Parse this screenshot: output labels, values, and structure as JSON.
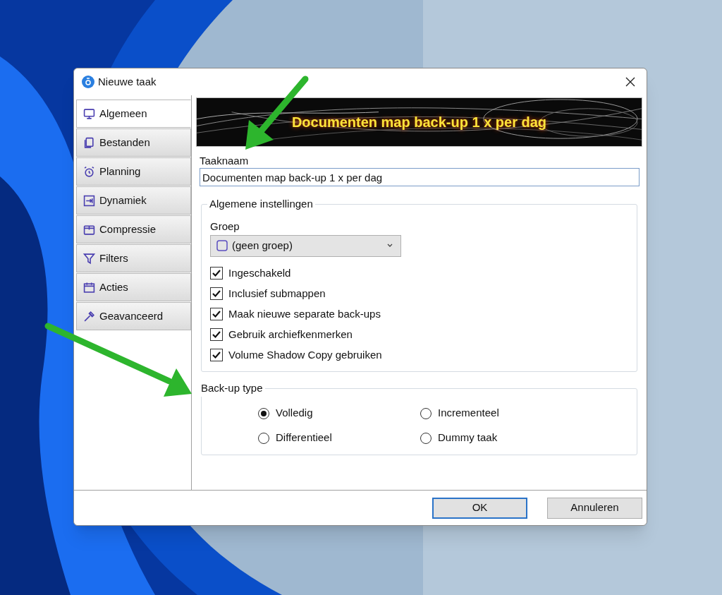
{
  "window": {
    "title": "Nieuwe taak"
  },
  "sidebar": {
    "items": [
      {
        "label": "Algemeen",
        "selected": true
      },
      {
        "label": "Bestanden",
        "selected": false
      },
      {
        "label": "Planning",
        "selected": false
      },
      {
        "label": "Dynamiek",
        "selected": false
      },
      {
        "label": "Compressie",
        "selected": false
      },
      {
        "label": "Filters",
        "selected": false
      },
      {
        "label": "Acties",
        "selected": false
      },
      {
        "label": "Geavanceerd",
        "selected": false
      }
    ]
  },
  "banner": {
    "title": "Documenten map back-up 1 x per dag"
  },
  "task_name": {
    "label": "Taaknaam",
    "value": "Documenten map back-up 1 x per dag"
  },
  "general_settings": {
    "title": "Algemene instellingen",
    "group": {
      "label": "Groep",
      "value": "(geen groep)"
    },
    "options": [
      {
        "label": "Ingeschakeld",
        "checked": true
      },
      {
        "label": "Inclusief submappen",
        "checked": true
      },
      {
        "label": "Maak nieuwe separate back-ups",
        "checked": true
      },
      {
        "label": "Gebruik archiefkenmerken",
        "checked": true
      },
      {
        "label": "Volume Shadow Copy gebruiken",
        "checked": true
      }
    ]
  },
  "backup_type": {
    "title": "Back-up type",
    "options": [
      {
        "label": "Volledig",
        "selected": true
      },
      {
        "label": "Incrementeel",
        "selected": false
      },
      {
        "label": "Differentieel",
        "selected": false
      },
      {
        "label": "Dummy taak",
        "selected": false
      }
    ]
  },
  "buttons": [
    {
      "label": "OK",
      "kind": "default"
    },
    {
      "label": "Annuleren",
      "kind": "normal"
    }
  ]
}
